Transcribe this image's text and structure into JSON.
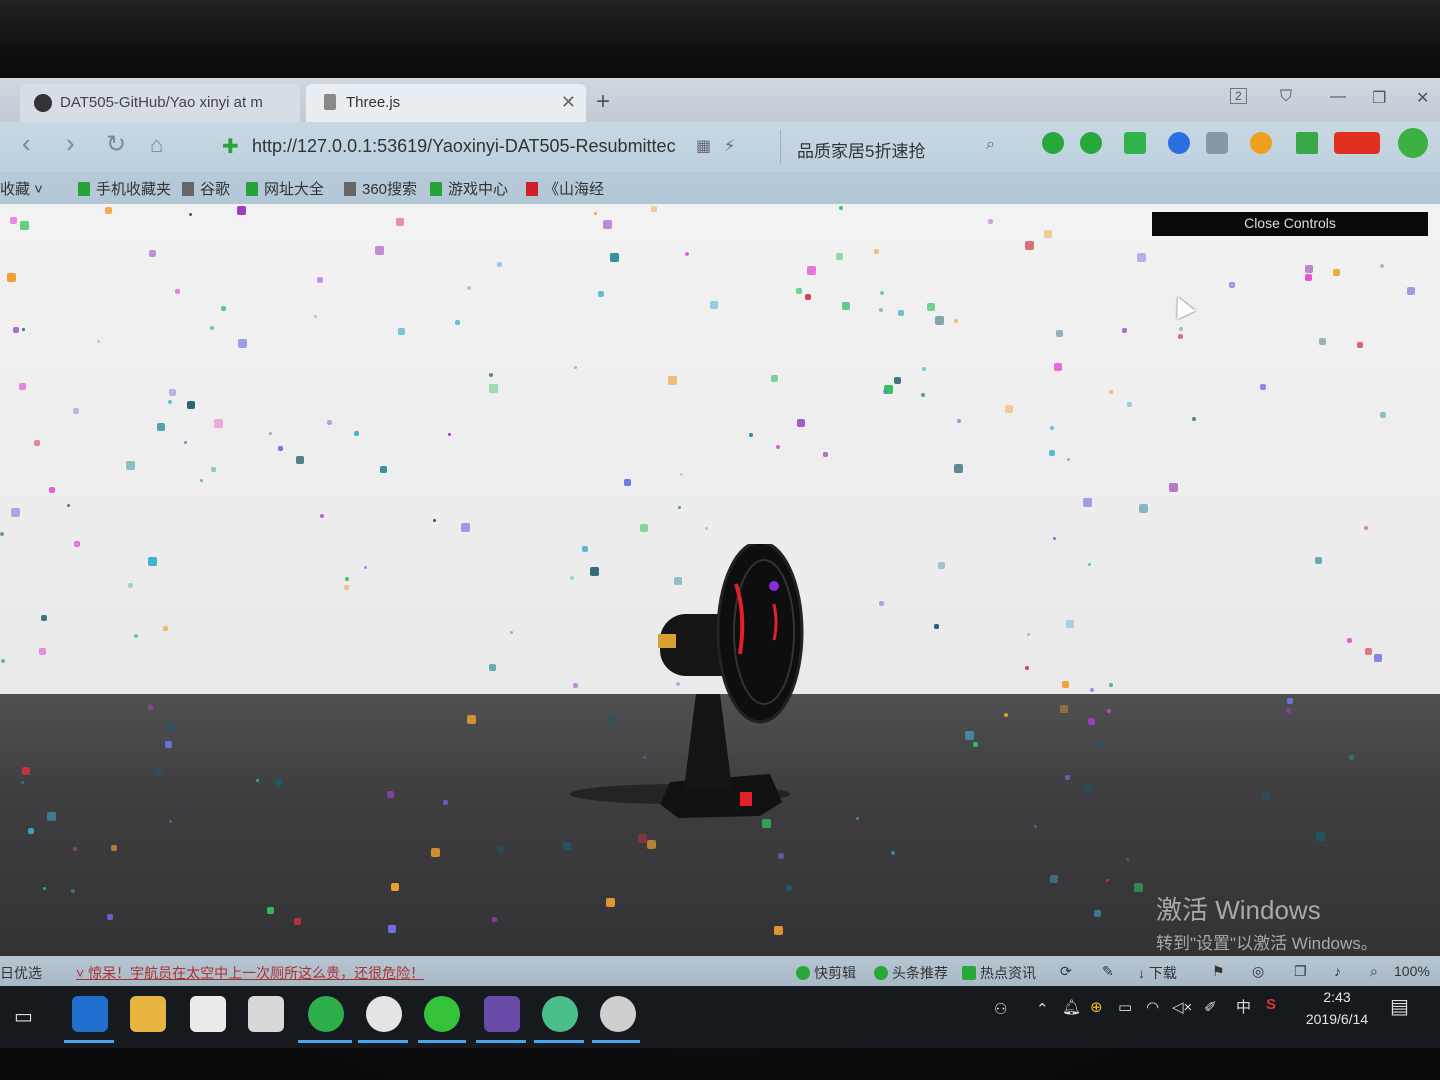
{
  "browser": {
    "tabs": [
      {
        "label": "DAT505-GitHub/Yao xinyi at m"
      },
      {
        "label": "Three.js"
      }
    ],
    "new_tab": "+",
    "window_counter": "2",
    "url": "http://127.0.0.1:53619/Yaoxinyi-DAT505-Resubmittec",
    "search_text": "品质家居5折速抢"
  },
  "bookmarks": [
    {
      "label": "收藏"
    },
    {
      "label": "手机收藏夹"
    },
    {
      "label": "谷歌"
    },
    {
      "label": "网址大全"
    },
    {
      "label": "360搜索"
    },
    {
      "label": "游戏中心"
    },
    {
      "label": "《山海经"
    }
  ],
  "scene": {
    "controls_button": "Close Controls",
    "watermark_title": "激活 Windows",
    "watermark_sub": "转到\"设置\"以激活 Windows。"
  },
  "statusbar": {
    "left_label": "日优选",
    "news": "惊呆！宇航员在太空中上一次厕所这么贵，还很危险！",
    "items": [
      "快剪辑",
      "头条推荐",
      "热点资讯",
      "下载"
    ],
    "zoom": "100%"
  },
  "taskbar": {
    "ime": "中",
    "time": "2:43",
    "date": "2019/6/14"
  },
  "colors": {
    "accent_green": "#27a83a",
    "fan_red": "#e0202a",
    "fan_body": "#111111"
  }
}
